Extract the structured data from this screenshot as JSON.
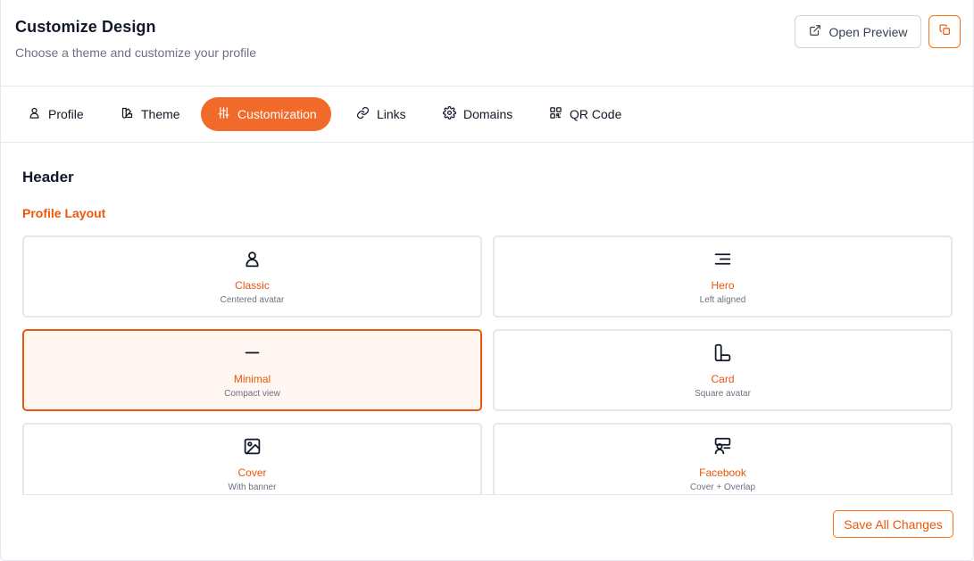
{
  "header": {
    "title": "Customize Design",
    "subtitle": "Choose a theme and customize your profile",
    "open_preview_label": "Open Preview"
  },
  "tabs": [
    {
      "label": "Profile",
      "icon": "user-icon",
      "active": false
    },
    {
      "label": "Theme",
      "icon": "swatch-icon",
      "active": false
    },
    {
      "label": "Customization",
      "icon": "sliders-icon",
      "active": true
    },
    {
      "label": "Links",
      "icon": "link-icon",
      "active": false
    },
    {
      "label": "Domains",
      "icon": "gear-icon",
      "active": false
    },
    {
      "label": "QR Code",
      "icon": "qr-code-icon",
      "active": false
    }
  ],
  "section": {
    "title": "Header",
    "subtitle": "Profile Layout"
  },
  "layouts": [
    {
      "name": "Classic",
      "desc": "Centered avatar",
      "icon": "user-icon",
      "selected": false
    },
    {
      "name": "Hero",
      "desc": "Left aligned",
      "icon": "align-lines-icon",
      "selected": false
    },
    {
      "name": "Minimal",
      "desc": "Compact view",
      "icon": "minus-icon",
      "selected": true
    },
    {
      "name": "Card",
      "desc": "Square avatar",
      "icon": "card-shape-icon",
      "selected": false
    },
    {
      "name": "Cover",
      "desc": "With banner",
      "icon": "image-icon",
      "selected": false
    },
    {
      "name": "Facebook",
      "desc": "Cover + Overlap",
      "icon": "cover-overlap-icon",
      "selected": false
    }
  ],
  "footer": {
    "save_label": "Save All Changes"
  },
  "colors": {
    "accent": "#f26a2a",
    "accent_text": "#ea580c",
    "selected_bg": "#fff6f1"
  }
}
